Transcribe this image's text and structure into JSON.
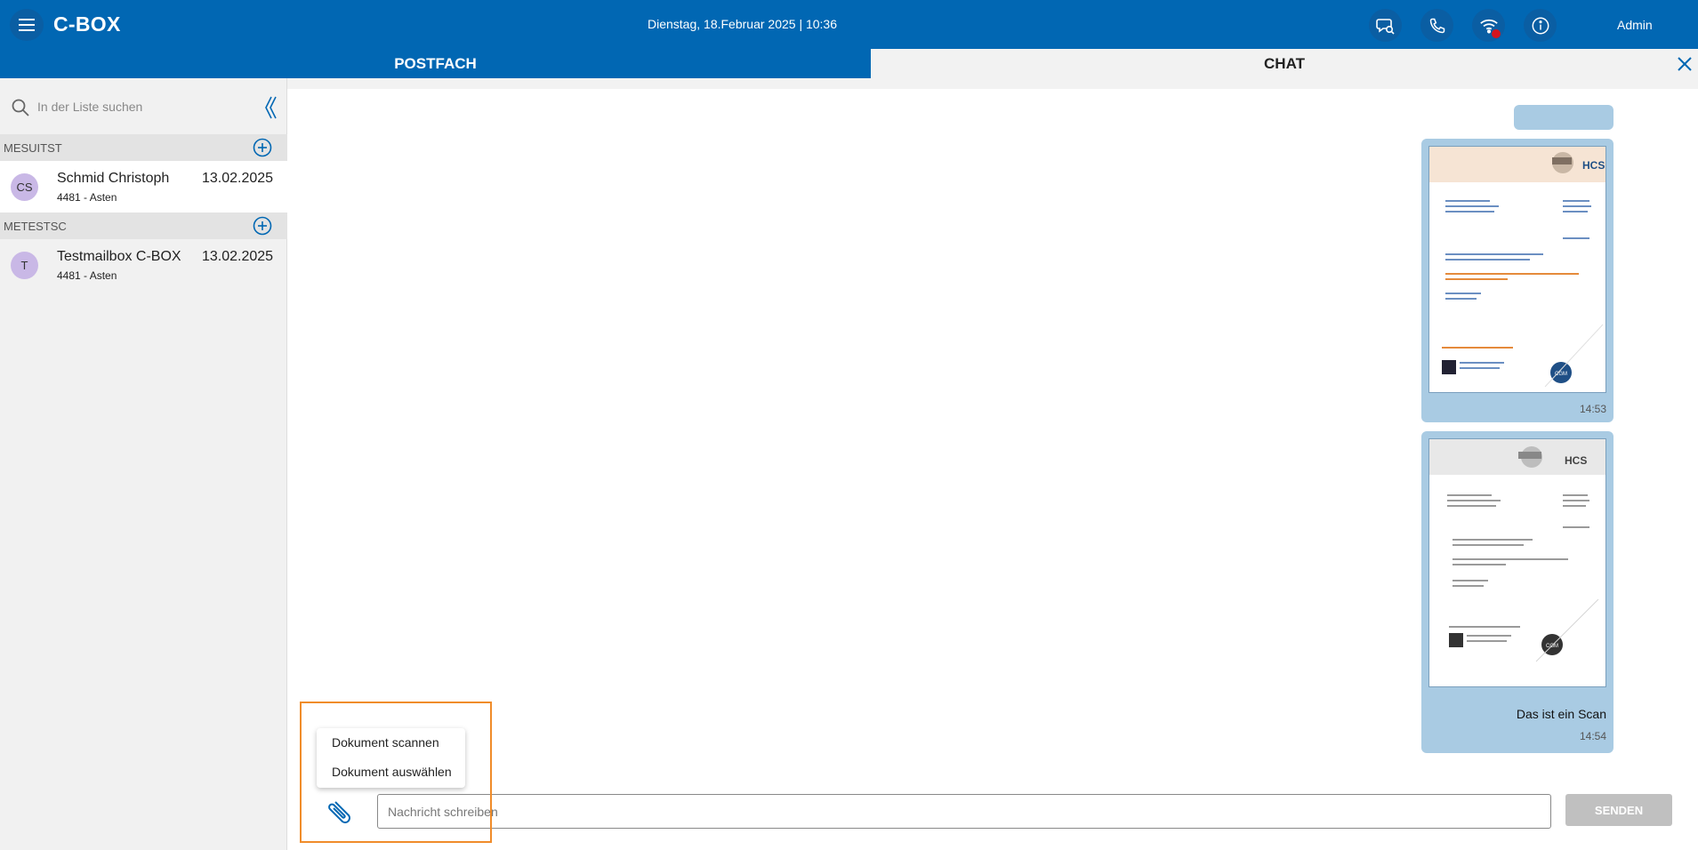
{
  "header": {
    "app_title": "C-BOX",
    "datetime": "Dienstag, 18.Februar 2025 | 10:36",
    "user": "Admin",
    "icons": [
      "menu-icon",
      "chat-search-icon",
      "phone-icon",
      "wifi-icon",
      "info-icon"
    ]
  },
  "tabs": [
    {
      "label": "POSTFACH"
    },
    {
      "label": "CHAT"
    }
  ],
  "sidebar": {
    "search_placeholder": "In der Liste suchen",
    "groups": [
      {
        "label": "MESUITST",
        "conversations": [
          {
            "initials": "CS",
            "name": "Schmid Christoph",
            "sub": "4481 - Asten",
            "date": "13.02.2025",
            "selected": true
          }
        ]
      },
      {
        "label": "METESTSC",
        "conversations": [
          {
            "initials": "T",
            "name": "Testmailbox C-BOX",
            "sub": "4481 - Asten",
            "date": "13.02.2025",
            "selected": false
          }
        ]
      }
    ]
  },
  "chat": {
    "messages": [
      {
        "type": "document",
        "time": "14:53",
        "caption": ""
      },
      {
        "type": "document",
        "time": "14:54",
        "caption": "Das ist ein Scan"
      }
    ],
    "input_placeholder": "Nachricht schreiben",
    "send_label": "SENDEN",
    "attach_menu": [
      "Dokument scannen",
      "Dokument auswählen"
    ]
  },
  "colors": {
    "primary": "#0167b3",
    "bubble": "#a9cbe3",
    "avatar": "#c9b8e6",
    "highlight": "#f08c2a",
    "status_red": "#d5141d"
  }
}
